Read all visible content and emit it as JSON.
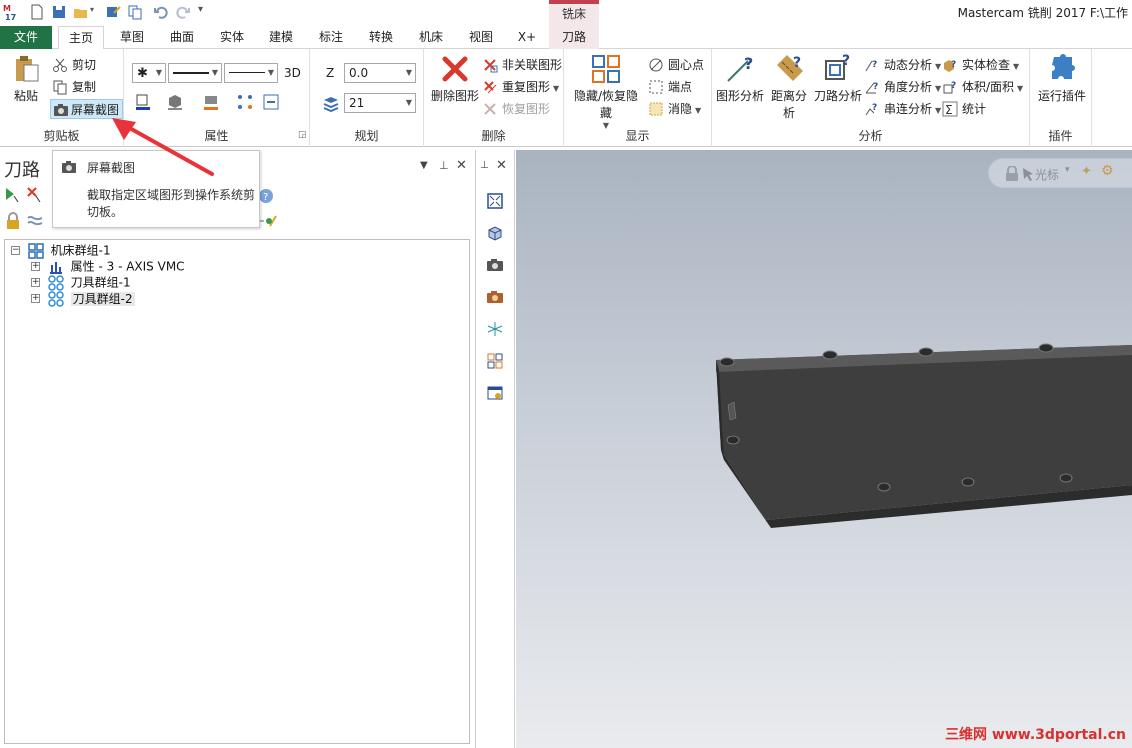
{
  "window": {
    "title": "Mastercam 铣削 2017  F:\\工作"
  },
  "ribbon_tabs": {
    "context_group": "铣床",
    "items": [
      "文件",
      "主页",
      "草图",
      "曲面",
      "实体",
      "建模",
      "标注",
      "转换",
      "机床",
      "视图",
      "X+",
      "刀路"
    ]
  },
  "clipboard": {
    "paste": "粘贴",
    "cut": "剪切",
    "copy": "复制",
    "screenshot": "屏幕截图",
    "label": "剪贴板"
  },
  "attributes": {
    "dimension": "3D",
    "label": "属性"
  },
  "planning": {
    "z_label": "Z",
    "z_value": "0.0",
    "level_value": "21",
    "label": "规划"
  },
  "delete": {
    "delete_entities": "删除图形",
    "unassociate": "非关联图形",
    "duplicate": "重复图形",
    "restore": "恢复图形",
    "label": "删除"
  },
  "display": {
    "hide_unhide": "隐藏/恢复隐藏",
    "arc_centers": "圆心点",
    "endpoints": "端点",
    "blank": "消隐",
    "label": "显示"
  },
  "analyze": {
    "entity": "图形分析",
    "distance": "距离分析",
    "toolpath": "刀路分析",
    "dynamic": "动态分析",
    "angle": "角度分析",
    "chain": "串连分析",
    "solid_check": "实体检查",
    "volume_area": "体积/面积",
    "statistics": "统计",
    "label": "分析"
  },
  "addins": {
    "run_addin": "运行插件",
    "label": "插件"
  },
  "tooltip": {
    "title": "屏幕截图",
    "description": "截取指定区域图形到操作系统剪切板。"
  },
  "toolpath_panel": {
    "title": "刀路",
    "tree": [
      {
        "label": "机床群组-1",
        "expander": "⊟"
      },
      {
        "label": "属性 - 3 - AXIS VMC",
        "expander": "⊞"
      },
      {
        "label": "刀具群组-1",
        "expander": "⊞"
      },
      {
        "label": "刀具群组-2",
        "expander": "⊞"
      }
    ]
  },
  "graphics": {
    "cursor_label": "光标"
  },
  "watermark": "三维网 www.3dportal.cn",
  "colors": {
    "file_tab": "#217346",
    "context_accent": "#c2404f",
    "context_bg": "#f4e7e9",
    "arrow": "#e8333a",
    "part": "#4a4a4a"
  }
}
